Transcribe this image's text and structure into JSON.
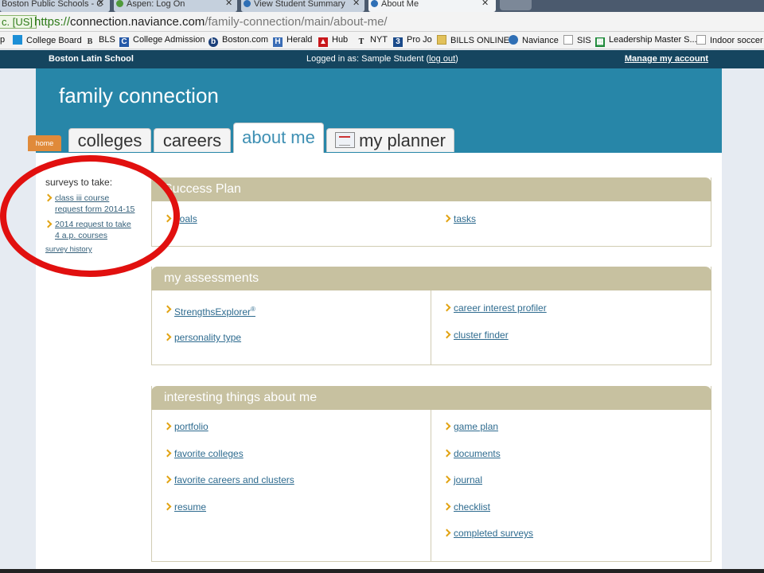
{
  "browser": {
    "tabs": [
      {
        "label": "Boston Public Schools - C",
        "active": false
      },
      {
        "label": "Aspen: Log On",
        "active": false
      },
      {
        "label": "View Student Summary",
        "active": false
      },
      {
        "label": "About Me",
        "active": true
      }
    ],
    "secure_label": "c. [US]",
    "url_protocol": "https://",
    "url_host": "connection.naviance.com",
    "url_path": "/family-connection/main/about-me/",
    "bookmarks": [
      {
        "label": "p",
        "icon": "bookmark-icon"
      },
      {
        "label": "College Board",
        "icon": "collegeboard-icon"
      },
      {
        "label": "BLS",
        "icon": "bls-icon"
      },
      {
        "label": "College Admission",
        "icon": "c-icon"
      },
      {
        "label": "Boston.com",
        "icon": "boston-icon"
      },
      {
        "label": "Herald",
        "icon": "herald-icon"
      },
      {
        "label": "Hub",
        "icon": "hub-icon"
      },
      {
        "label": "NYT",
        "icon": "nyt-icon"
      },
      {
        "label": "Pro Jo",
        "icon": "projo-icon"
      },
      {
        "label": "BILLS ONLINE",
        "icon": "folder-icon"
      },
      {
        "label": "Naviance",
        "icon": "naviance-icon"
      },
      {
        "label": "SIS",
        "icon": "page-icon"
      },
      {
        "label": "Leadership Master S...",
        "icon": "sheet-icon"
      },
      {
        "label": "Indoor soccer",
        "icon": "page-icon"
      }
    ]
  },
  "site": {
    "school": "Boston Latin School",
    "logged_in_prefix": "Logged in as: Sample Student (",
    "logout_label": "log out",
    "logged_in_suffix": ")",
    "manage_account": "Manage my account"
  },
  "header": {
    "brand": "family connection",
    "home_tab": "home",
    "tabs": [
      {
        "label": "colleges",
        "active": false
      },
      {
        "label": "careers",
        "active": false
      },
      {
        "label": "about me",
        "active": true
      },
      {
        "label": "my planner",
        "active": false
      }
    ]
  },
  "surveys": {
    "title": "surveys to take:",
    "items": [
      {
        "line1": "class iii course",
        "line2": "request form 2014-15"
      },
      {
        "line1": "2014 request to take",
        "line2": "4 a.p. courses"
      }
    ],
    "history": "survey history"
  },
  "panels": {
    "success": {
      "title": "Success Plan",
      "left": [
        "goals"
      ],
      "right": [
        "tasks"
      ]
    },
    "assessments": {
      "title": "my assessments",
      "left": [
        "StrengthsExplorer",
        "personality type"
      ],
      "left_sup": "®",
      "right": [
        "career interest profiler",
        "cluster finder"
      ]
    },
    "interesting": {
      "title": "interesting things about me",
      "left": [
        "portfolio",
        "favorite colleges",
        "favorite careers and clusters",
        "resume"
      ],
      "right": [
        "game plan",
        "documents",
        "journal",
        "checklist",
        "completed surveys"
      ]
    }
  }
}
